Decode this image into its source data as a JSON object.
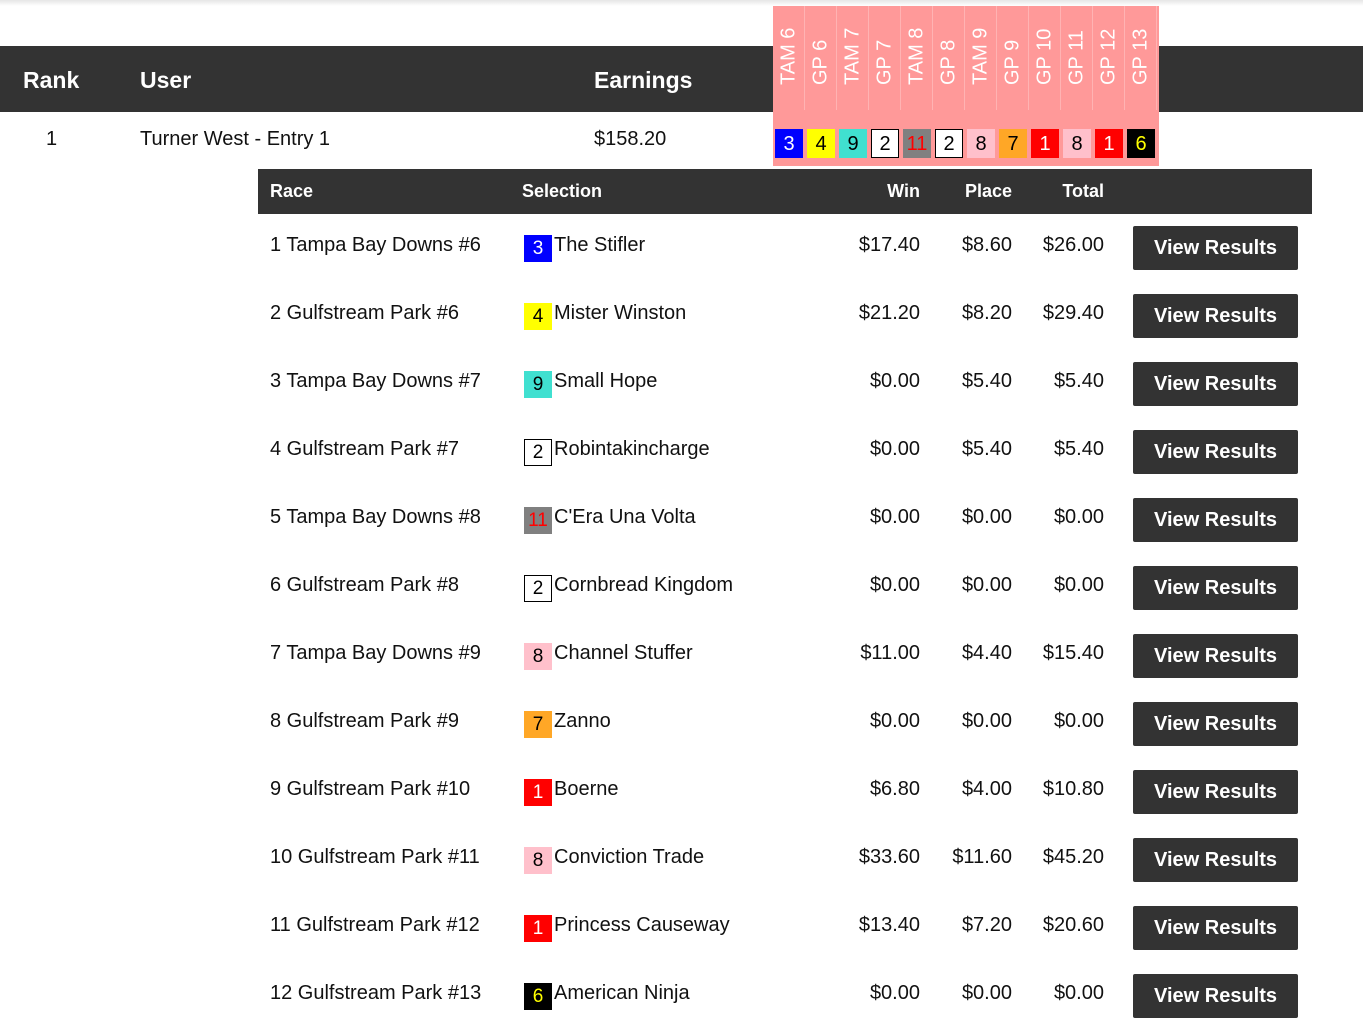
{
  "leaderboard": {
    "headers": {
      "rank": "Rank",
      "user": "User",
      "earnings": "Earnings"
    },
    "race_columns": [
      "TAM 6",
      "GP 6",
      "TAM 7",
      "GP 7",
      "TAM 8",
      "GP 8",
      "TAM 9",
      "GP 9",
      "GP 10",
      "GP 11",
      "GP 12",
      "GP 13"
    ],
    "entry": {
      "rank": "1",
      "user": "Turner West - Entry 1",
      "earnings": "$158.20"
    },
    "chips": [
      {
        "num": "3",
        "bg": "#0000ff",
        "fg": "#ffffff",
        "border": "#0000ff"
      },
      {
        "num": "4",
        "bg": "#ffff00",
        "fg": "#000000",
        "border": "#ffff00"
      },
      {
        "num": "9",
        "bg": "#40e0d0",
        "fg": "#000000",
        "border": "#40e0d0"
      },
      {
        "num": "2",
        "bg": "#ffffff",
        "fg": "#000000",
        "border": "#000000"
      },
      {
        "num": "11",
        "bg": "#808080",
        "fg": "#ff0000",
        "border": "#808080"
      },
      {
        "num": "2",
        "bg": "#ffffff",
        "fg": "#000000",
        "border": "#000000"
      },
      {
        "num": "8",
        "bg": "#ffc0cb",
        "fg": "#000000",
        "border": "#ffc0cb"
      },
      {
        "num": "7",
        "bg": "#ffa726",
        "fg": "#000000",
        "border": "#ffa726"
      },
      {
        "num": "1",
        "bg": "#ff0000",
        "fg": "#ffffff",
        "border": "#ff0000"
      },
      {
        "num": "8",
        "bg": "#ffc0cb",
        "fg": "#000000",
        "border": "#ffc0cb"
      },
      {
        "num": "1",
        "bg": "#ff0000",
        "fg": "#ffffff",
        "border": "#ff0000"
      },
      {
        "num": "6",
        "bg": "#000000",
        "fg": "#ffff00",
        "border": "#000000"
      }
    ]
  },
  "detail": {
    "headers": {
      "race": "Race",
      "selection": "Selection",
      "win": "Win",
      "place": "Place",
      "total": "Total"
    },
    "button_label": "View Results",
    "rows": [
      {
        "race": "1 Tampa Bay Downs #6",
        "num": "3",
        "horse": "The Stifler",
        "win": "$17.40",
        "place": "$8.60",
        "total": "$26.00"
      },
      {
        "race": "2 Gulfstream Park #6",
        "num": "4",
        "horse": "Mister Winston",
        "win": "$21.20",
        "place": "$8.20",
        "total": "$29.40"
      },
      {
        "race": "3 Tampa Bay Downs #7",
        "num": "9",
        "horse": "Small Hope",
        "win": "$0.00",
        "place": "$5.40",
        "total": "$5.40"
      },
      {
        "race": "4 Gulfstream Park #7",
        "num": "2",
        "horse": "Robintakincharge",
        "win": "$0.00",
        "place": "$5.40",
        "total": "$5.40"
      },
      {
        "race": "5 Tampa Bay Downs #8",
        "num": "11",
        "horse": "C'Era Una Volta",
        "win": "$0.00",
        "place": "$0.00",
        "total": "$0.00"
      },
      {
        "race": "6 Gulfstream Park #8",
        "num": "2",
        "horse": "Cornbread Kingdom",
        "win": "$0.00",
        "place": "$0.00",
        "total": "$0.00"
      },
      {
        "race": "7 Tampa Bay Downs #9",
        "num": "8",
        "horse": "Channel Stuffer",
        "win": "$11.00",
        "place": "$4.40",
        "total": "$15.40"
      },
      {
        "race": "8 Gulfstream Park #9",
        "num": "7",
        "horse": "Zanno",
        "win": "$0.00",
        "place": "$0.00",
        "total": "$0.00"
      },
      {
        "race": "9 Gulfstream Park #10",
        "num": "1",
        "horse": "Boerne",
        "win": "$6.80",
        "place": "$4.00",
        "total": "$10.80"
      },
      {
        "race": "10 Gulfstream Park #11",
        "num": "8",
        "horse": "Conviction Trade",
        "win": "$33.60",
        "place": "$11.60",
        "total": "$45.20"
      },
      {
        "race": "11 Gulfstream Park #12",
        "num": "1",
        "horse": "Princess Causeway",
        "win": "$13.40",
        "place": "$7.20",
        "total": "$20.60"
      },
      {
        "race": "12 Gulfstream Park #13",
        "num": "6",
        "horse": "American Ninja",
        "win": "$0.00",
        "place": "$0.00",
        "total": "$0.00"
      }
    ]
  }
}
